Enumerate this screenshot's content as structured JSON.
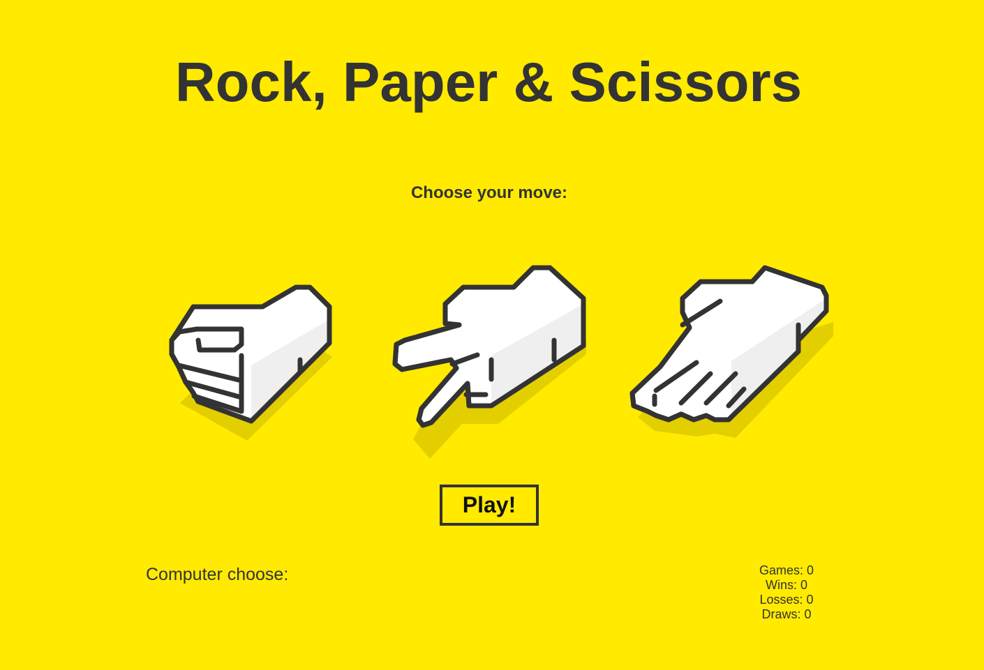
{
  "header": {
    "title": "Rock, Paper & Scissors"
  },
  "game": {
    "prompt": "Choose your move:",
    "moves": [
      {
        "id": "rock",
        "icon": "fist-hand-icon"
      },
      {
        "id": "scissors",
        "icon": "two-finger-hand-icon"
      },
      {
        "id": "paper",
        "icon": "open-hand-icon"
      }
    ],
    "play_label": "Play!",
    "computer_label": "Computer choose:"
  },
  "stats": {
    "games": "Games: 0",
    "wins": "Wins: 0",
    "losses": "Losses: 0",
    "draws": "Draws: 0"
  },
  "colors": {
    "background": "#FFEA00",
    "ink": "#333333",
    "hand_fill": "#FFFFFF",
    "hand_side": "#EFEFEF",
    "shadow": "#E3CF00"
  }
}
